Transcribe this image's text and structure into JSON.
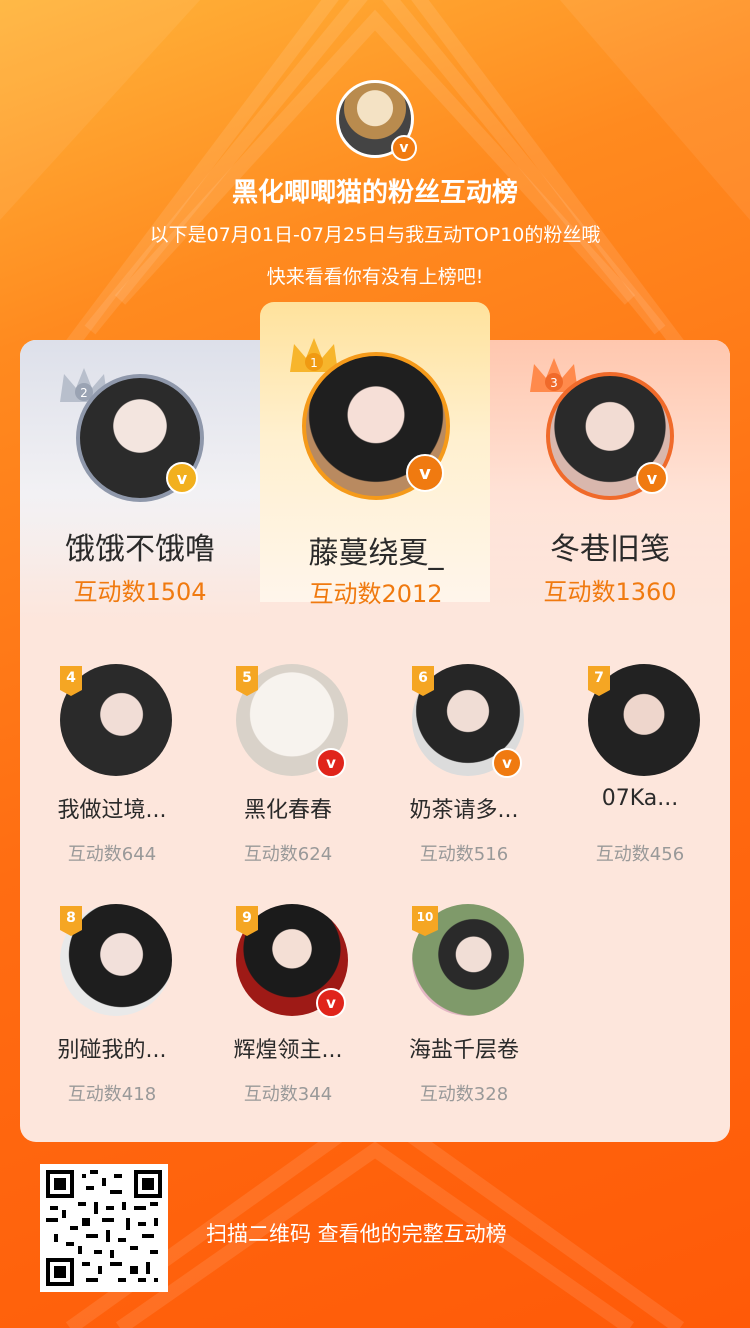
{
  "colors": {
    "background": "#ff6d12",
    "accent": "#f07a10",
    "rank_flag": "#f5a623",
    "verified_badge": "#f07a10"
  },
  "header": {
    "title": "黑化唧唧猫的粉丝互动榜",
    "subtitle": "以下是07月01日-07月25日与我互动TOP10的粉丝哦",
    "tagline": "快来看看你有没有上榜吧!"
  },
  "top3": [
    {
      "rank": "1",
      "name": "藤蔓绕夏_",
      "count": "互动数2012",
      "verified": true
    },
    {
      "rank": "2",
      "name": "饿饿不饿噜",
      "count": "互动数1504",
      "verified": true
    },
    {
      "rank": "3",
      "name": "冬巷旧笺",
      "count": "互动数1360",
      "verified": true
    }
  ],
  "ranks": [
    {
      "rank": "4",
      "name": "我做过境...",
      "count": "互动数644",
      "verified": false
    },
    {
      "rank": "5",
      "name": "黑化春春",
      "count": "互动数624",
      "verified": true
    },
    {
      "rank": "6",
      "name": "奶茶请多...",
      "count": "互动数516",
      "verified": true
    },
    {
      "rank": "7",
      "name": "07Ka...",
      "count": "互动数456",
      "verified": false
    },
    {
      "rank": "8",
      "name": "别碰我的...",
      "count": "互动数418",
      "verified": false
    },
    {
      "rank": "9",
      "name": "辉煌领主...",
      "count": "互动数344",
      "verified": true
    },
    {
      "rank": "10",
      "name": "海盐千层卷",
      "count": "互动数328",
      "verified": false
    }
  ],
  "footer": {
    "scan_text": "扫描二维码 查看他的完整互动榜"
  },
  "icons": {
    "verified": "v-badge-icon",
    "crown": "crown-icon",
    "qr": "qr-code-icon"
  }
}
